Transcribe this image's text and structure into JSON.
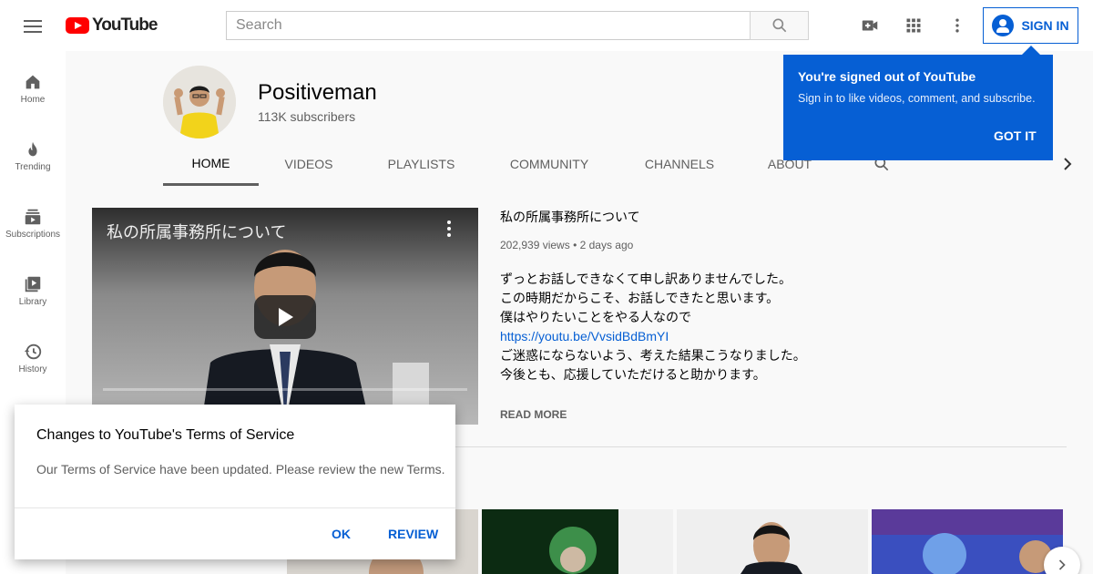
{
  "header": {
    "logo_text": "YouTube",
    "search_placeholder": "Search",
    "signin_label": "SIGN IN"
  },
  "sidebar": {
    "items": [
      {
        "label": "Home",
        "icon": "home-icon"
      },
      {
        "label": "Trending",
        "icon": "flame-icon"
      },
      {
        "label": "Subscriptions",
        "icon": "subscriptions-icon"
      },
      {
        "label": "Library",
        "icon": "library-icon"
      },
      {
        "label": "History",
        "icon": "history-icon"
      }
    ]
  },
  "channel": {
    "name": "Positiveman",
    "subscribers": "113K subscribers",
    "tabs": [
      {
        "label": "HOME",
        "active": true
      },
      {
        "label": "VIDEOS"
      },
      {
        "label": "PLAYLISTS"
      },
      {
        "label": "COMMUNITY"
      },
      {
        "label": "CHANNELS"
      },
      {
        "label": "ABOUT"
      }
    ]
  },
  "featured": {
    "title": "私の所属事務所について",
    "overlay_title": "私の所属事務所について",
    "views": "202,939 views",
    "age": "2 days ago",
    "description": [
      "ずっとお話しできなくて申し訳ありませんでした。",
      "この時期だからこそ、お話しできたと思います。",
      "僕はやりたいことをやる人なので",
      "https://youtu.be/VvsidBdBmYI",
      "ご迷惑にならないよう、考えた結果こうなりました。",
      "今後とも、応援していただけると助かります。"
    ],
    "read_more": "READ MORE"
  },
  "signed_out_popup": {
    "title": "You're signed out of YouTube",
    "body": "Sign in to like videos, comment, and subscribe.",
    "button": "GOT IT"
  },
  "terms_dialog": {
    "title": "Changes to YouTube's Terms of Service",
    "body": "Our Terms of Service have been updated. Please review the new Terms.",
    "ok": "OK",
    "review": "REVIEW"
  },
  "colors": {
    "accent": "#065fd4",
    "brand_red": "#ff0000"
  }
}
